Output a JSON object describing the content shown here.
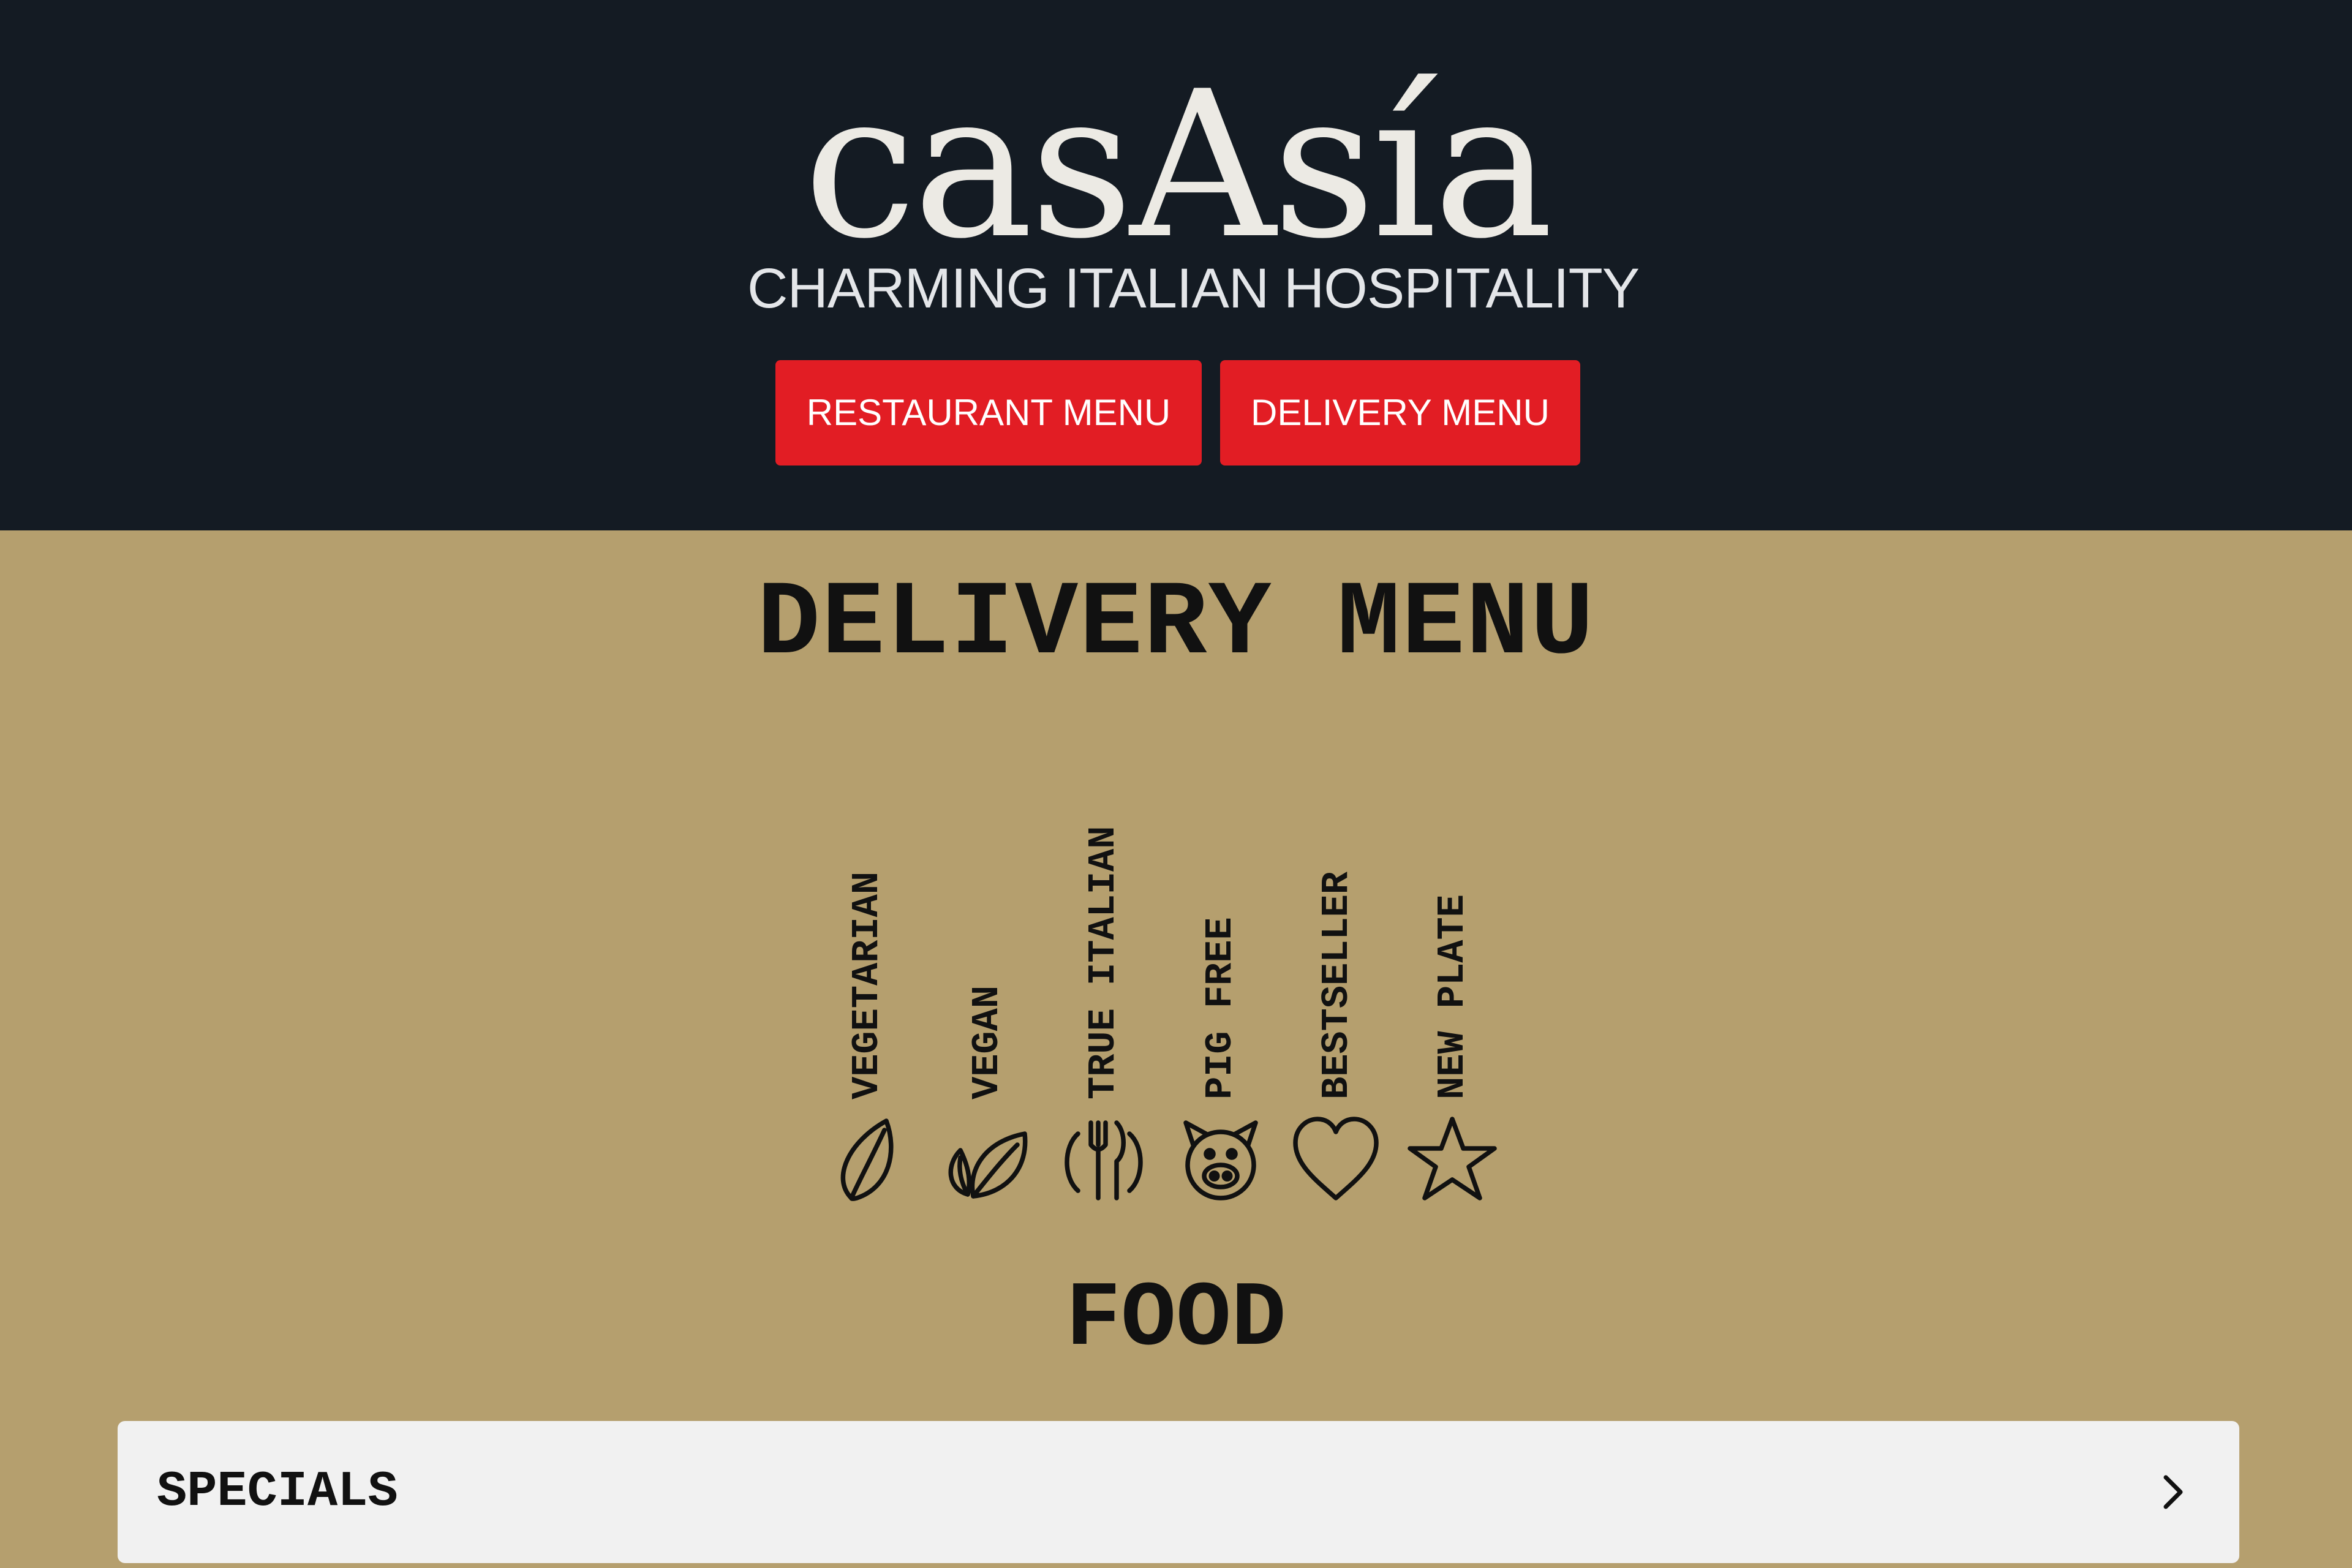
{
  "header": {
    "logo_text": "casAsía",
    "tagline": "CHARMING ITALIAN HOSPITALITY",
    "buttons": [
      {
        "label": "RESTAURANT MENU"
      },
      {
        "label": "DELIVERY MENU"
      }
    ],
    "colors": {
      "background": "#141b23",
      "button": "#e21d24"
    }
  },
  "page": {
    "title": "DELIVERY MENU",
    "background": "#b59f6e"
  },
  "legend": [
    {
      "label": "VEGETARIAN",
      "icon": "leaf-icon"
    },
    {
      "label": "VEGAN",
      "icon": "double-leaf-icon"
    },
    {
      "label": "TRUE ITALIAN",
      "icon": "fork-knife-icon"
    },
    {
      "label": "PIG FREE",
      "icon": "pig-icon"
    },
    {
      "label": "BESTSELLER",
      "icon": "heart-icon"
    },
    {
      "label": "NEW PLATE",
      "icon": "star-icon"
    }
  ],
  "food": {
    "title": "FOOD",
    "sections": [
      {
        "label": "SPECIALS",
        "icon": "chevron-right-icon"
      }
    ]
  }
}
